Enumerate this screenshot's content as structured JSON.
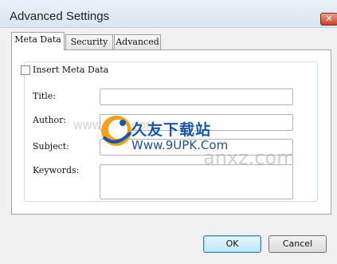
{
  "window": {
    "title": "Advanced Settings",
    "close_glyph": "✕"
  },
  "tabs": [
    {
      "label": "Meta Data",
      "active": true
    },
    {
      "label": "Security",
      "active": false
    },
    {
      "label": "Advanced",
      "active": false
    }
  ],
  "meta": {
    "insert_label": "Insert Meta Data",
    "insert_checked": false,
    "fields": [
      {
        "label": "Title:",
        "value": ""
      },
      {
        "label": "Author:",
        "value": ""
      },
      {
        "label": "Subject:",
        "value": ""
      },
      {
        "label": "Keywords:",
        "value": ""
      }
    ]
  },
  "watermark": {
    "title": "久友下载站",
    "url": "Www.9UPK.Com",
    "faint_left": "WWW.9UPK.COM",
    "faint_right": "anxz.com",
    "accent_colors": [
      "#f2a01e",
      "#1a55a8"
    ]
  },
  "buttons": {
    "ok": "OK",
    "cancel": "Cancel"
  }
}
